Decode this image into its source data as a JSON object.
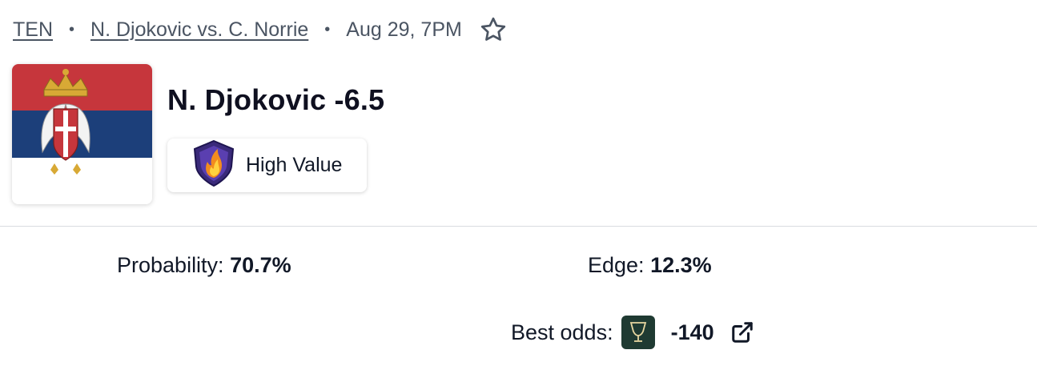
{
  "breadcrumb": {
    "sport": "TEN",
    "match": "N. Djokovic vs. C. Norrie",
    "date": "Aug 29, 7PM",
    "separator": "•"
  },
  "pick": {
    "title": "N. Djokovic -6.5",
    "flag_icon": "serbia-flag",
    "badge_label": "High Value",
    "badge_icon": "flame-shield-icon"
  },
  "stats": {
    "probability_label": "Probability:",
    "probability_value": "70.7%",
    "edge_label": "Edge:",
    "edge_value": "12.3%",
    "best_odds_label": "Best odds:",
    "best_odds_value": "-140",
    "book_icon": "sportsbook-goblet-icon"
  },
  "colors": {
    "flag_red": "#c6363c",
    "flag_blue": "#1c3f7a",
    "book_bg": "#1f3a32",
    "text": "#111827",
    "muted": "#4b5563"
  }
}
